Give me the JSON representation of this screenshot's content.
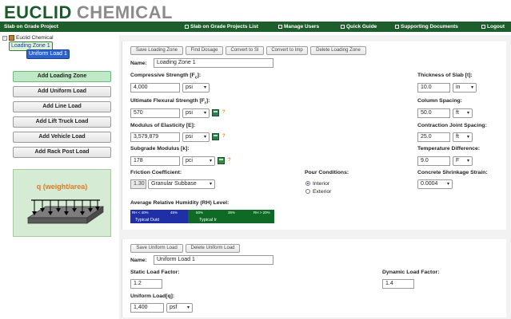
{
  "brand": {
    "word1": "EUCLID",
    "word2": "CHEMICAL"
  },
  "topbar": {
    "app_title": "Slab on Grade Project",
    "nav": [
      {
        "label": "Slab on Grade Projects List"
      },
      {
        "label": "Manage Users"
      },
      {
        "label": "Quick Guide"
      },
      {
        "label": "Supporting Documents"
      },
      {
        "label": "Logout"
      }
    ]
  },
  "tree": {
    "root": "Euclid Chemical",
    "zone": "Loading Zone 1",
    "load": "Uniform Load 1"
  },
  "sidebar": {
    "buttons": [
      {
        "label": "Add Loading Zone"
      },
      {
        "label": "Add Uniform Load"
      },
      {
        "label": "Add Line Load"
      },
      {
        "label": "Add Lift Truck Load"
      },
      {
        "label": "Add Vehicle Load"
      },
      {
        "label": "Add Rack Post Load"
      }
    ],
    "diagram_caption": "q (weight/area)"
  },
  "zone_panel": {
    "toolbar": [
      "Save Loading Zone",
      "Find Dosage",
      "Convert to SI",
      "Convert to Imp",
      "Delete Loading Zone"
    ],
    "name_label": "Name:",
    "name_value": "Loading Zone 1",
    "compressive": {
      "label": "Compressive Strength [F",
      "label_sub": "c",
      "label_end": "]:",
      "value": "4,000",
      "unit": "psi"
    },
    "flexural": {
      "label": "Ultimate Flexural Strength [F",
      "label_sub": "r",
      "label_end": "]:",
      "value": "570",
      "unit": "psi"
    },
    "modulus": {
      "label": "Modulus of Elasticity [E]:",
      "value": "3,579,879",
      "unit": "psi"
    },
    "subgrade": {
      "label": "Subgrade Modulus [k]:",
      "value": "178",
      "unit": "pci"
    },
    "friction": {
      "label": "Friction Coefficient:",
      "value": "1.30",
      "option": "Granular Subbase"
    },
    "pour": {
      "label": "Pour Conditions:",
      "options": [
        "Interior",
        "Exterior"
      ],
      "selected": "Interior"
    },
    "rh": {
      "label": "Average Relative Humidity (RH) Level:",
      "segments": [
        {
          "top": "RH < 40%",
          "bottom": "Typical Outdoor",
          "color": "#1f2fa6"
        },
        {
          "top": "45%",
          "bottom": "",
          "color": "#1f2fa6"
        },
        {
          "top": "50%",
          "bottom": "",
          "color": "#0f6a25"
        },
        {
          "top": "35%",
          "bottom": "Typical Indoor",
          "color": "#0f6a25"
        },
        {
          "top": "RH > 20%",
          "bottom": "",
          "color": "#0f6a25"
        }
      ]
    },
    "thickness": {
      "label": "Thickness of Slab [t]:",
      "value": "10.0",
      "unit": "in"
    },
    "column": {
      "label": "Column Spacing:",
      "value": "50.0",
      "unit": "ft"
    },
    "contraction": {
      "label": "Contraction Joint Spacing:",
      "value": "25.0",
      "unit": "ft"
    },
    "temperature": {
      "label": "Temperature Difference:",
      "value": "9.0",
      "unit": "F"
    },
    "shrinkage": {
      "label": "Concrete Shrinkage Strain:",
      "value": "0.0004"
    }
  },
  "load_panel": {
    "toolbar": [
      "Save Uniform Load",
      "Delete Uniform Load"
    ],
    "name_label": "Name:",
    "name_value": "Uniform Load 1",
    "static": {
      "label": "Static Load Factor:",
      "value": "1.2"
    },
    "dynamic": {
      "label": "Dynamic Load Factor:",
      "value": "1.4"
    },
    "uniform": {
      "label": "Uniform Load[q]:",
      "value": "1,400",
      "unit": "psf"
    }
  }
}
